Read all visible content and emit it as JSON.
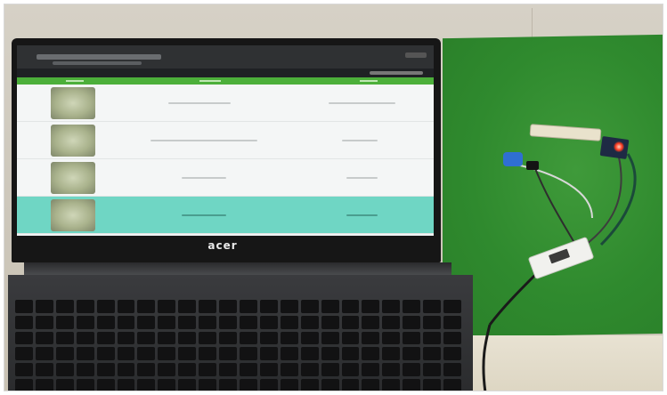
{
  "photo": {
    "brand_logo": "acer"
  },
  "scene": {
    "table_rows": 4
  },
  "colors": {
    "mat_green": "#2f8a2e",
    "table_header_green": "#4caf3a",
    "highlight_row": "#6fd6c4",
    "led_red": "#ff3b1f",
    "sensor_blue": "#2f6fd2"
  }
}
